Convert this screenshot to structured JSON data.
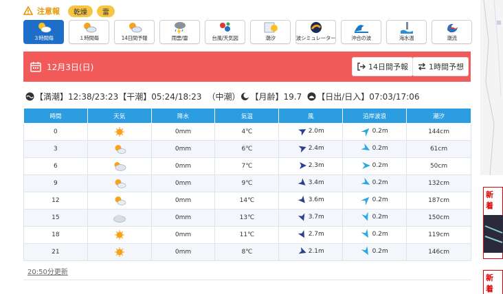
{
  "warning": {
    "label": "注意報",
    "badges": [
      "乾燥",
      "雷"
    ],
    "color": "#e69500"
  },
  "tabs": [
    {
      "label": "３時間毎",
      "icon": "sun-cloud-icon",
      "active": true
    },
    {
      "label": "１時間毎",
      "icon": "sun-cloud-icon",
      "active": false
    },
    {
      "label": "14日間予報",
      "icon": "sun-cloud-icon",
      "active": false
    },
    {
      "label": "雨雲/雷",
      "icon": "rain-cloud-icon",
      "active": false
    },
    {
      "label": "台風/天気図",
      "icon": "typhoon-icon",
      "active": false
    },
    {
      "label": "潮汐",
      "icon": "moon-calendar-icon",
      "active": false
    },
    {
      "label": "波シミュレーター",
      "icon": "wave-sim-icon",
      "active": false
    },
    {
      "label": "沖合の波",
      "icon": "offshore-wave-icon",
      "active": false
    },
    {
      "label": "海水温",
      "icon": "sea-temp-icon",
      "active": false
    },
    {
      "label": "潮流",
      "icon": "current-icon",
      "active": false
    }
  ],
  "datebar": {
    "date": "12月3日(日)",
    "btn_14day": "14日間予報",
    "btn_1hour": "1時間予想",
    "color": "#f25a5a"
  },
  "tide": {
    "high_label": "【満潮】",
    "high": "12:38/23:23",
    "low_label": "【干潮】",
    "low": "05:24/18:23",
    "type": "（中潮）",
    "moon_label": "【月齢】",
    "moon": "19.7",
    "sun_label": "【日出/日入】",
    "sun": "07:03/17:06"
  },
  "table": {
    "headers": [
      "時間",
      "天気",
      "降水",
      "気温",
      "風",
      "沿岸波浪",
      "潮汐"
    ],
    "rows": [
      {
        "time": "0",
        "weather": "sunny",
        "rain": "0mm",
        "temp": "4℃",
        "wind": "2.0m",
        "wind_dir": 60,
        "wave": "0.2m",
        "wave_dir": 45,
        "tide": "144cm"
      },
      {
        "time": "3",
        "weather": "sunny-cloudy",
        "rain": "0mm",
        "temp": "6℃",
        "wind": "2.4m",
        "wind_dir": 70,
        "wave": "0.2m",
        "wave_dir": 120,
        "tide": "61cm"
      },
      {
        "time": "6",
        "weather": "cloudy-sunny",
        "rain": "0mm",
        "temp": "7℃",
        "wind": "2.3m",
        "wind_dir": 90,
        "wave": "0.2m",
        "wave_dir": 90,
        "tide": "50cm"
      },
      {
        "time": "9",
        "weather": "sunny-cloudy",
        "rain": "0mm",
        "temp": "9℃",
        "wind": "3.4m",
        "wind_dir": 130,
        "wave": "0.2m",
        "wave_dir": 120,
        "tide": "132cm"
      },
      {
        "time": "12",
        "weather": "sunny-cloudy",
        "rain": "0mm",
        "temp": "14℃",
        "wind": "3.6m",
        "wind_dir": 140,
        "wave": "0.2m",
        "wave_dir": 45,
        "tide": "187cm"
      },
      {
        "time": "15",
        "weather": "cloudy",
        "rain": "0mm",
        "temp": "13℃",
        "wind": "3.7m",
        "wind_dir": 160,
        "wave": "0.2m",
        "wave_dir": 160,
        "tide": "150cm"
      },
      {
        "time": "18",
        "weather": "sunny",
        "rain": "0mm",
        "temp": "11℃",
        "wind": "2.7m",
        "wind_dir": 150,
        "wave": "0.2m",
        "wave_dir": 150,
        "tide": "119cm"
      },
      {
        "time": "21",
        "weather": "sunny",
        "rain": "0mm",
        "temp": "8℃",
        "wind": "2.1m",
        "wind_dir": 110,
        "wave": "0.2m",
        "wave_dir": 150,
        "tide": "146cm"
      }
    ]
  },
  "updated": "20:50分更新",
  "side_ads": [
    "新着",
    "新着"
  ],
  "colors": {
    "header": "#2d9de2",
    "active_tab": "#1d6ec9",
    "arrow": "#2a3f8f",
    "wave_arrow": "#2aa9e0",
    "sun": "#f7a21b"
  }
}
